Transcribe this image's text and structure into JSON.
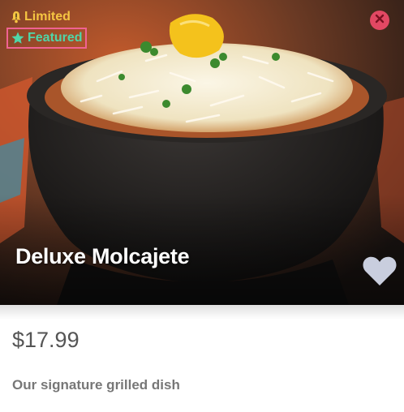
{
  "badges": {
    "limited_label": "Limited",
    "featured_label": "Featured",
    "limited_color": "#f5c542",
    "featured_color": "#4fd6a8",
    "limited_icon": "bell-icon",
    "featured_icon": "star-icon"
  },
  "item": {
    "title": "Deluxe Molcajete",
    "price": "$17.99",
    "description": "Our signature grilled dish"
  },
  "controls": {
    "close_icon": "close-icon",
    "close_color": "#e24863",
    "favorite_icon": "heart-icon"
  }
}
